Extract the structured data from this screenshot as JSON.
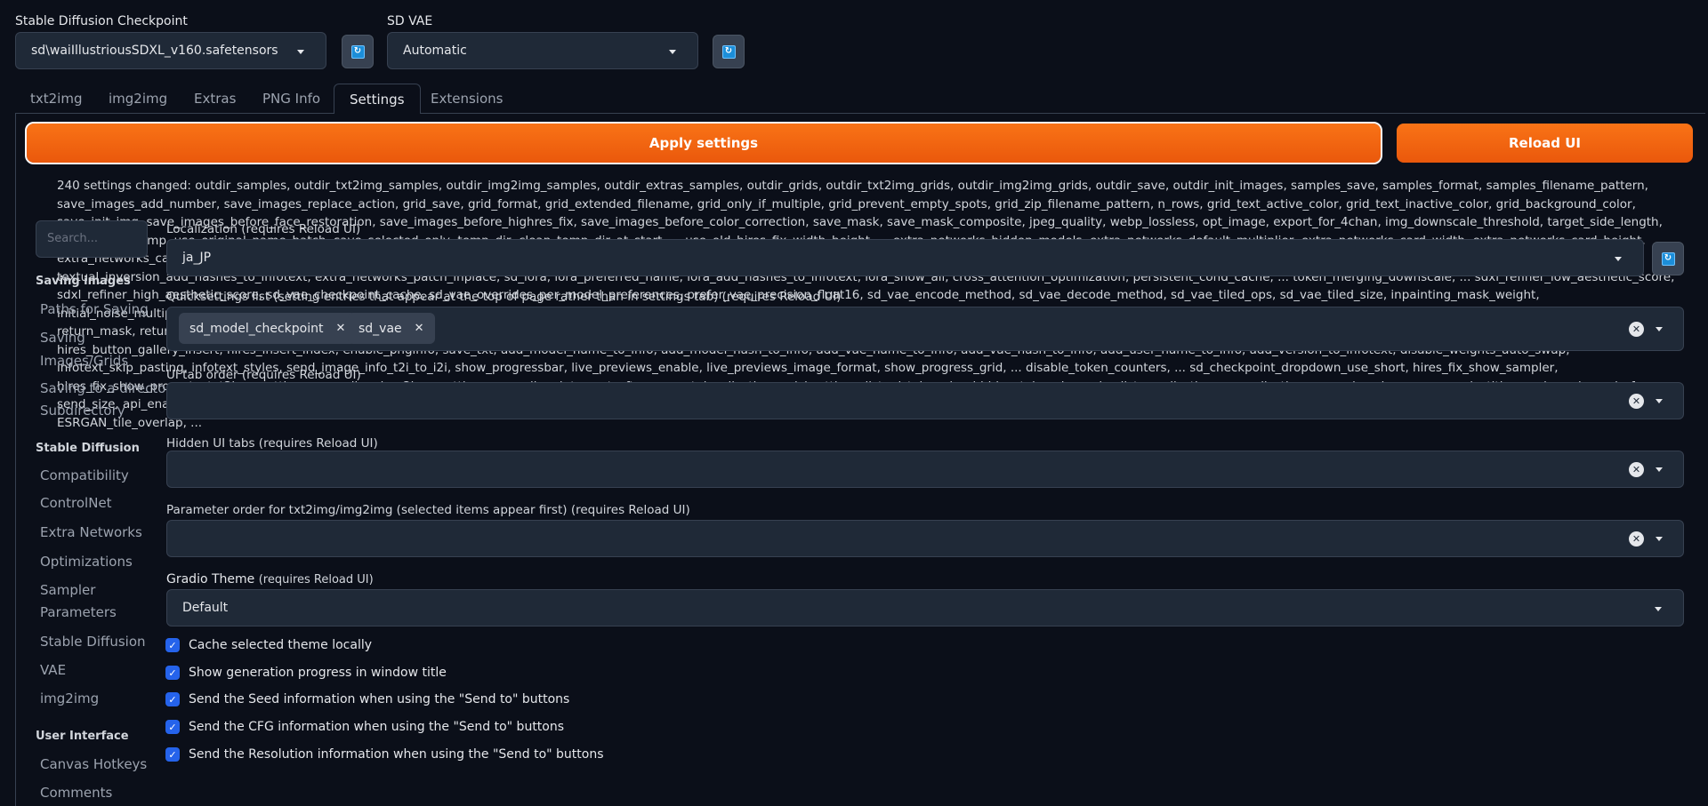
{
  "header": {
    "checkpoint": {
      "label": "Stable Diffusion Checkpoint",
      "value": "sd\\waiIllustriousSDXL_v160.safetensors"
    },
    "vae": {
      "label": "SD VAE",
      "value": "Automatic"
    },
    "refresh_icon": "refresh-icon"
  },
  "tabs": [
    "txt2img",
    "img2img",
    "Extras",
    "PNG Info",
    "Settings",
    "Extensions"
  ],
  "active_tab": "Settings",
  "buttons": {
    "apply": "Apply settings",
    "reload": "Reload UI"
  },
  "changed_settings": "240 settings changed: outdir_samples, outdir_txt2img_samples, outdir_img2img_samples, outdir_extras_samples, outdir_grids, outdir_txt2img_grids, outdir_img2img_grids, outdir_save, outdir_init_images, samples_save, samples_format, samples_filename_pattern, save_images_add_number, save_images_replace_action, grid_save, grid_format, grid_extended_filename, grid_only_if_multiple, grid_prevent_empty_spots, grid_zip_filename_pattern, n_rows, grid_text_active_color, grid_text_inactive_color, grid_background_color, save_init_img, save_images_before_face_restoration, save_images_before_highres_fix, save_images_before_color_correction, save_mask, save_mask_composite, jpeg_quality, webp_lossless, opt_image, export_for_4chan, img_downscale_threshold, target_side_length, img_max_size_mp, use_original_name_batch, save_selected_only, temp_dir, clean_temp_dir_at_start, ... use_old_hires_fix_width_height, ... extra_networks_hidden_models, extra_networks_default_multiplier, extra_networks_card_width, extra_networks_card_height, extra_networks_card_text_scale, extra_networks_card_show_desc, extra_networks_card_description_is_html, extra_networks_card_order_field, extra_networks_card_order, extra_networks_add_text_separator, ui_extra_networks_tab_reorder, textual_inversion_add_hashes_to_infotext, extra_networks_patch_inplace, sd_lora, lora_preferred_name, lora_add_hashes_to_infotext, lora_show_all, cross_attention_optimization, persistent_cond_cache, ... token_merging_downscale, ... sdxl_refiner_low_aesthetic_score, sdxl_refiner_high_aesthetic_score, sd_vae_checkpoint_cache, sd_vae_overrides_per_model_preferences, prefer_vae_precision_float16, sd_vae_encode_method, sd_vae_decode_method, sd_vae_tiled_ops, sd_vae_tiled_size, inpainting_mask_weight, initial_noise_multiplier, img2img_extra_noise, img2img_color_correction, img2img_fix_steps, img2img_editor_height, img2img_background_color, img2img_inpaint_mask_brush_color, img2img_sketch_default_brush_color, img2img_inpaint_sketch_default_brush_color, return_mask, return_mask_composite, ... canvas_hotkey_overlap, ... js_modal_lightbox_gamepad, js_modal_lightbox_gamepad_repeat, sd_webui_modal_lightbox_icon_opacity, sd_webui_modal_lightbox_toolbar_opacity, open_dir_button_choice, hires_button_gallery_insert, hires_insert_index, enable_pnginfo, save_txt, add_model_name_to_info, add_model_hash_to_info, add_vae_name_to_info, add_vae_hash_to_info, add_user_name_to_info, add_version_to_infotext, disable_weights_auto_swap, infotext_skip_pasting, infotext_styles, send_image_info_t2i_to_i2i, show_progressbar, live_previews_enable, live_previews_image_format, show_progress_grid, ... disable_token_counters, ... sd_checkpoint_dropdown_use_short, hires_fix_show_sampler, hires_fix_show_prompts, txt2img_settings_accordion, img2img_settings_accordion, interrupt_after_current, localization, quicksettings_list, ui_tab_order, hidden_tabs, ui_reorder_list, gradio_theme, gradio_themes_cache, show_progress_in_title, send_seed, send_cfg, send_size, api_enable_requests, api_forbid_local_requests, api_useragent, auto_launch_browser, enable_console_prompts, samples_log_stdout, show_warnings, show_gradio_deprecation_warnings, memmon_poll_rate, multiple_tqdm, enable_upscale_progressbar, ... ESRGAN_tile_overlap, ...",
  "search": {
    "placeholder": "Search..."
  },
  "sidebar": {
    "section1": "Saving images",
    "section1_items": [
      "Paths for Saving",
      "Saving",
      "Images/Grids",
      "Saving to a directory",
      "Subdirectory"
    ],
    "section2": "Stable Diffusion",
    "section2_items": [
      "Compatibility",
      "ControlNet",
      "Extra Networks",
      "Optimizations",
      "Sampler",
      "Parameters",
      "Stable Diffusion",
      "VAE",
      "img2img"
    ],
    "section3": "User Interface",
    "section3_items": [
      "Canvas Hotkeys",
      "Comments"
    ]
  },
  "localization": {
    "label": "Localization (requires Reload UI)",
    "value": "ja_JP"
  },
  "quicksettings": {
    "label": "Quicksettings list (setting entries that appear at the top of page rather than in settings tab) (requires Reload UI)",
    "chips": [
      "sd_model_checkpoint",
      "sd_vae"
    ]
  },
  "ui_tab_order": {
    "label": "UI tab order (requires Reload UI)"
  },
  "hidden_tabs": {
    "label": "Hidden UI tabs (requires Reload UI)"
  },
  "ui_reorder": {
    "label": "Parameter order for txt2img/img2img (selected items appear first) (requires Reload UI)"
  },
  "gradio_theme": {
    "label": "Gradio Theme",
    "sublabel": "(requires Reload UI)",
    "value": "Default"
  },
  "checkboxes": [
    {
      "label": "Cache selected theme locally",
      "checked": true
    },
    {
      "label": "Show generation progress in window title",
      "checked": true
    },
    {
      "label": "Send the Seed information when using the \"Send to\" buttons",
      "checked": true
    },
    {
      "label": "Send the CFG information when using the \"Send to\" buttons",
      "checked": true
    },
    {
      "label": "Send the Resolution information when using the \"Send to\" buttons",
      "checked": true
    }
  ]
}
